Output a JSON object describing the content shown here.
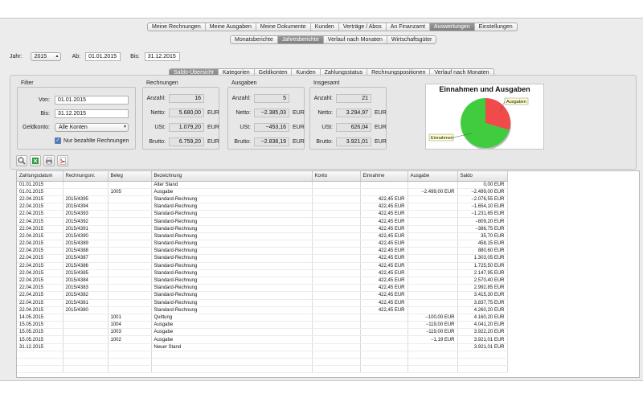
{
  "main_tabs": [
    "Meine Rechnungen",
    "Meine Ausgaben",
    "Meine Dokumente",
    "Kunden",
    "Verträge / Abos",
    "An Finanzamt",
    "Auswertungen",
    "Einstellungen"
  ],
  "main_tabs_active": 6,
  "sub_tabs": [
    "Monatsberichte",
    "Jahresberichte",
    "Verlauf nach Monaten",
    "Wirtschaftsgüter"
  ],
  "sub_tabs_active": 1,
  "header": {
    "jahr_label": "Jahr:",
    "jahr_value": "2015",
    "ab_label": "Ab:",
    "ab_value": "01.01.2015",
    "bis_label": "Bis:",
    "bis_value": "31.12.2015"
  },
  "report_tabs": [
    "Saldo-Übersicht",
    "Kategorien",
    "Geldkonten",
    "Kunden",
    "Zahlungsstatus",
    "Rechnungspositionen",
    "Verlauf nach Monaten"
  ],
  "report_tabs_active": 0,
  "filter": {
    "title": "Filter",
    "von_label": "Von:",
    "von_value": "01.01.2015",
    "bis_label": "Bis:",
    "bis_value": "31.12.2015",
    "geldkonto_label": "Geldkonto:",
    "geldkonto_value": "Alle Konten",
    "checkbox_label": "Nur bezahlte Rechnungen",
    "checkbox_checked": true
  },
  "groups": [
    {
      "title": "Rechnungen",
      "rows": [
        {
          "label": "Anzahl:",
          "value": "16",
          "unit": ""
        },
        {
          "label": "Netto:",
          "value": "5.680,00",
          "unit": "EUR"
        },
        {
          "label": "USt:",
          "value": "1.079,20",
          "unit": "EUR"
        },
        {
          "label": "Brutto:",
          "value": "6.759,20",
          "unit": "EUR"
        }
      ]
    },
    {
      "title": "Ausgaben",
      "rows": [
        {
          "label": "Anzahl:",
          "value": "5",
          "unit": ""
        },
        {
          "label": "Netto:",
          "value": "−2.385,03",
          "unit": "EUR"
        },
        {
          "label": "USt:",
          "value": "−453,16",
          "unit": "EUR"
        },
        {
          "label": "Brutto:",
          "value": "−2.838,19",
          "unit": "EUR"
        }
      ]
    },
    {
      "title": "Insgesamt",
      "rows": [
        {
          "label": "Anzahl:",
          "value": "21",
          "unit": ""
        },
        {
          "label": "Netto:",
          "value": "3.294,97",
          "unit": "EUR"
        },
        {
          "label": "USt:",
          "value": "626,04",
          "unit": "EUR"
        },
        {
          "label": "Brutto:",
          "value": "3.921,01",
          "unit": "EUR"
        }
      ]
    }
  ],
  "chart_data": {
    "type": "pie",
    "title": "Einnahmen und Ausgaben",
    "categories": [
      "Einnahmen",
      "Ausgaben"
    ],
    "values": [
      6759.2,
      2838.19
    ],
    "colors": [
      "#3fcc3f",
      "#f04a4a"
    ]
  },
  "toolbar_icons": [
    "search-icon",
    "export-excel-icon",
    "print-icon",
    "pdf-icon"
  ],
  "table": {
    "columns": [
      "Zahlungsdatum",
      "Rechnungsnr.",
      "Beleg",
      "Bezeichnung",
      "Konto",
      "Einnahme",
      "Ausgabe",
      "Saldo"
    ],
    "rows": [
      [
        "01.01.2015",
        "",
        "",
        "Alter Stand",
        "",
        "",
        "",
        "0,00 EUR"
      ],
      [
        "01.01.2015",
        "",
        "1005",
        "Ausgabe",
        "",
        "",
        "−2.499,00 EUR",
        "−2.499,00 EUR"
      ],
      [
        "22.04.2015",
        "2015/4395",
        "",
        "Standard-Rechnung",
        "",
        "422,45 EUR",
        "",
        "−2.076,55 EUR"
      ],
      [
        "22.04.2015",
        "2015/4394",
        "",
        "Standard-Rechnung",
        "",
        "422,45 EUR",
        "",
        "−1.654,10 EUR"
      ],
      [
        "22.04.2015",
        "2015/4393",
        "",
        "Standard-Rechnung",
        "",
        "422,45 EUR",
        "",
        "−1.231,65 EUR"
      ],
      [
        "22.04.2015",
        "2015/4392",
        "",
        "Standard-Rechnung",
        "",
        "422,45 EUR",
        "",
        "−809,20 EUR"
      ],
      [
        "22.04.2015",
        "2015/4391",
        "",
        "Standard-Rechnung",
        "",
        "422,45 EUR",
        "",
        "−386,75 EUR"
      ],
      [
        "22.04.2015",
        "2015/4390",
        "",
        "Standard-Rechnung",
        "",
        "422,45 EUR",
        "",
        "35,70 EUR"
      ],
      [
        "22.04.2015",
        "2015/4389",
        "",
        "Standard-Rechnung",
        "",
        "422,45 EUR",
        "",
        "458,15 EUR"
      ],
      [
        "22.04.2015",
        "2015/4388",
        "",
        "Standard-Rechnung",
        "",
        "422,45 EUR",
        "",
        "880,60 EUR"
      ],
      [
        "22.04.2015",
        "2015/4387",
        "",
        "Standard-Rechnung",
        "",
        "422,45 EUR",
        "",
        "1.303,05 EUR"
      ],
      [
        "22.04.2015",
        "2015/4386",
        "",
        "Standard-Rechnung",
        "",
        "422,45 EUR",
        "",
        "1.725,50 EUR"
      ],
      [
        "22.04.2015",
        "2015/4385",
        "",
        "Standard-Rechnung",
        "",
        "422,45 EUR",
        "",
        "2.147,95 EUR"
      ],
      [
        "22.04.2015",
        "2015/4384",
        "",
        "Standard-Rechnung",
        "",
        "422,45 EUR",
        "",
        "2.570,40 EUR"
      ],
      [
        "22.04.2015",
        "2015/4383",
        "",
        "Standard-Rechnung",
        "",
        "422,45 EUR",
        "",
        "2.992,85 EUR"
      ],
      [
        "22.04.2015",
        "2015/4382",
        "",
        "Standard-Rechnung",
        "",
        "422,45 EUR",
        "",
        "3.415,30 EUR"
      ],
      [
        "22.04.2015",
        "2015/4381",
        "",
        "Standard-Rechnung",
        "",
        "422,45 EUR",
        "",
        "3.837,75 EUR"
      ],
      [
        "22.04.2015",
        "2015/4380",
        "",
        "Standard-Rechnung",
        "",
        "422,45 EUR",
        "",
        "4.260,20 EUR"
      ],
      [
        "14.05.2015",
        "",
        "1001",
        "Quittung",
        "",
        "",
        "−100,00 EUR",
        "4.160,20 EUR"
      ],
      [
        "15.05.2015",
        "",
        "1004",
        "Ausgabe",
        "",
        "",
        "−119,00 EUR",
        "4.041,20 EUR"
      ],
      [
        "15.05.2015",
        "",
        "1003",
        "Ausgabe",
        "",
        "",
        "−119,00 EUR",
        "3.922,20 EUR"
      ],
      [
        "15.05.2015",
        "",
        "1002",
        "Ausgabe",
        "",
        "",
        "−1,19 EUR",
        "3.921,01 EUR"
      ],
      [
        "31.12.2015",
        "",
        "",
        "Neuer Stand",
        "",
        "",
        "",
        "3.921,01 EUR"
      ]
    ]
  }
}
